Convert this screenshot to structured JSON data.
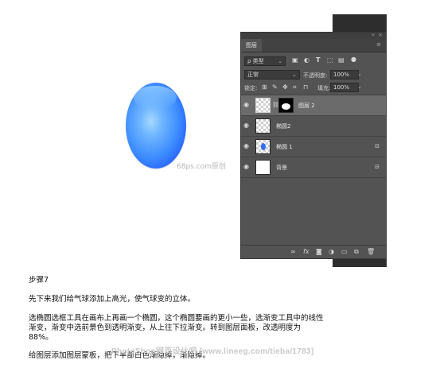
{
  "watermark_site": "68ps.com原创",
  "panel": {
    "tab": "图层",
    "collapse_glyph": "«",
    "close_glyph": "×",
    "menu_glyph": "≡",
    "filter": {
      "value": "ρ 类型",
      "icons": [
        "image-filter-icon",
        "adjustment-filter-icon",
        "type-filter-icon",
        "shape-filter-icon",
        "smartobject-filter-icon",
        "toggle-filter-icon"
      ]
    },
    "blend_mode": "正常",
    "opacity_label": "不透明度:",
    "opacity_value": "100%",
    "lock_label": "锁定:",
    "fill_label": "填充:",
    "fill_value": "100%",
    "layers": [
      {
        "name": "图层 2",
        "has_mask": true,
        "selected": true,
        "locked": false
      },
      {
        "name": "椭圆2",
        "has_mask": false,
        "selected": false,
        "locked": false
      },
      {
        "name": "椭圆 1",
        "has_mask": false,
        "selected": false,
        "locked": true
      },
      {
        "name": "背景",
        "has_mask": false,
        "selected": false,
        "locked": true
      }
    ],
    "bottom_icons": [
      "link-icon",
      "fx-icon",
      "mask-icon",
      "adjustment-icon",
      "folder-icon",
      "new-layer-icon",
      "trash-icon"
    ]
  },
  "text": {
    "step_title": "步骤7",
    "p1": "先下来我们给气球添加上高光，使气球变的立体。",
    "p2_line1": "选椭圆选框工具在画布上再画一个椭圆，这个椭圆要画的更小一些，选渐变工具中的线性",
    "p2_line2": "渐变，渐变中选前景色到透明渐变，从上往下拉渐变。转到图层面板，改透明度为",
    "p2_line3": "88%。",
    "p3": "给图层添加图层蒙板，把下半部白色渐隐掉，渐隐掉。"
  },
  "banner": "PhotoShop网页设计吧 [www.lineeg.com/tieba/1783]",
  "colors": {
    "panel_bg": "#535353",
    "selected_layer": "#6b6b6b",
    "balloon_dark": "#1f55ff",
    "balloon_light": "#6fb6ff"
  }
}
